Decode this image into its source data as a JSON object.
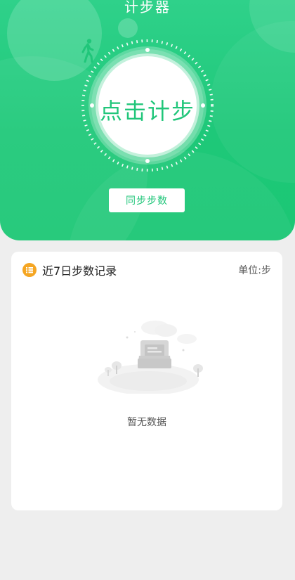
{
  "hero": {
    "title": "计步器",
    "dial_label": "点击计步",
    "sync_button": "同步步数"
  },
  "record_card": {
    "title": "近7日步数记录",
    "unit": "单位:步",
    "empty_text": "暂无数据"
  },
  "colors": {
    "primary": "#20c67a",
    "accent": "#f5a623",
    "background": "#eeeeee"
  },
  "icons": {
    "walk": "walk-icon",
    "list": "list-icon",
    "empty": "empty-data-icon"
  }
}
